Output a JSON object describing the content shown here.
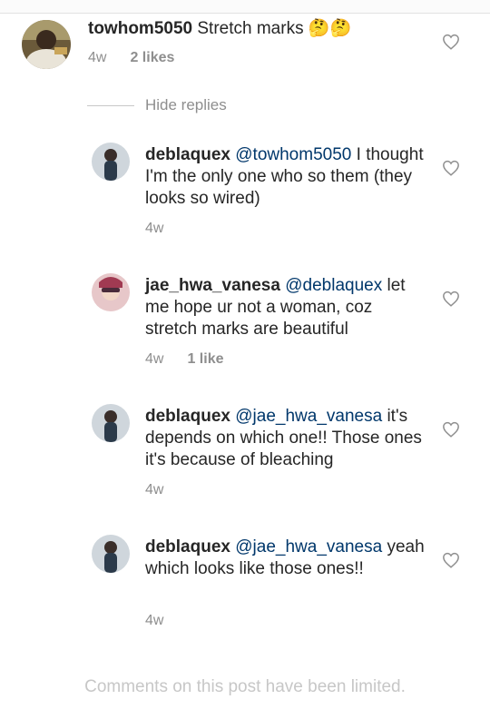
{
  "comment_main": {
    "username": "towhom5050",
    "text": " Stretch marks 🤔🤔",
    "time": "4w",
    "likes": "2 likes"
  },
  "hide_replies": "Hide replies",
  "replies": [
    {
      "username": "deblaquex",
      "mention": "@towhom5050",
      "text_line1": " I",
      "text_rest": "thought I'm the only one who so them (they looks so wired)",
      "time": "4w",
      "likes": ""
    },
    {
      "username": "jae_hwa_vanesa",
      "mention": "@deblaquex",
      "text_line1": " let",
      "text_rest": "me hope ur not a woman, coz stretch marks are beautiful",
      "time": "4w",
      "likes": "1 like"
    },
    {
      "username": "deblaquex",
      "mention": "@jae_hwa_vanesa",
      "text_line1": " it's",
      "text_rest": "depends on which one!! Those ones it's because of bleaching",
      "time": "4w",
      "likes": ""
    },
    {
      "username": "deblaquex",
      "mention": "@jae_hwa_vanesa",
      "text_line1": "",
      "text_rest": "yeah which looks like those ones!!",
      "time": "4w",
      "likes": ""
    }
  ],
  "footer": "Comments on this post have been limited.",
  "icons": {
    "like": "heart-outline-icon"
  }
}
